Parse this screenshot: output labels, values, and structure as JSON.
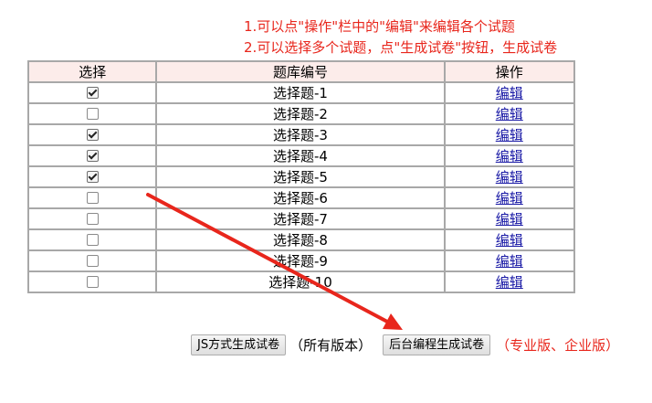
{
  "instructions": {
    "line1": "1.可以点\"操作\"栏中的\"编辑\"来编辑各个试题",
    "line2": "2.可以选择多个试题，点\"生成试卷\"按钮，生成试卷"
  },
  "table": {
    "headers": {
      "select": "选择",
      "id": "题库编号",
      "action": "操作"
    },
    "rows": [
      {
        "checked": true,
        "name": "选择题-1",
        "action": "编辑"
      },
      {
        "checked": false,
        "name": "选择题-2",
        "action": "编辑"
      },
      {
        "checked": true,
        "name": "选择题-3",
        "action": "编辑"
      },
      {
        "checked": true,
        "name": "选择题-4",
        "action": "编辑"
      },
      {
        "checked": true,
        "name": "选择题-5",
        "action": "编辑"
      },
      {
        "checked": false,
        "name": "选择题-6",
        "action": "编辑"
      },
      {
        "checked": false,
        "name": "选择题-7",
        "action": "编辑"
      },
      {
        "checked": false,
        "name": "选择题-8",
        "action": "编辑"
      },
      {
        "checked": false,
        "name": "选择题-9",
        "action": "编辑"
      },
      {
        "checked": false,
        "name": "选择题-10",
        "action": "编辑"
      }
    ]
  },
  "actions": {
    "js_button_label": "JS方式生成试卷",
    "js_note": "（所有版本）",
    "server_button_label": "后台编程生成试卷",
    "server_note": "（专业版、企业版）"
  },
  "colors": {
    "accent_red": "#e8261c",
    "header_bg": "#fcecea",
    "link": "#1a1aa6",
    "border": "#a8a8a8"
  }
}
